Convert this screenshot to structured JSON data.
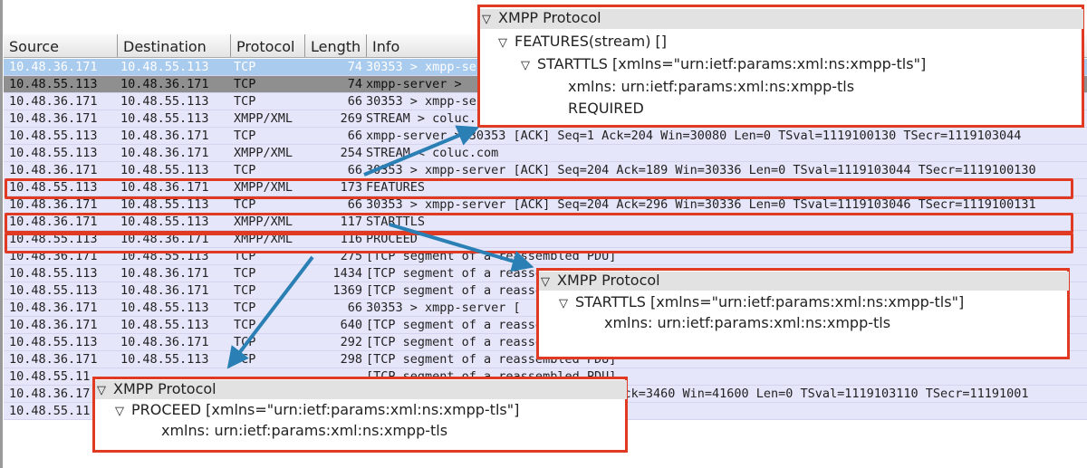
{
  "columns": [
    "Source",
    "Destination",
    "Protocol",
    "Length",
    "Info"
  ],
  "rows": [
    {
      "src": "10.48.36.171",
      "dst": "10.48.55.113",
      "proto": "TCP",
      "len": "74",
      "info": "30353 > xmpp-server",
      "state": "selected"
    },
    {
      "src": "10.48.55.113",
      "dst": "10.48.36.171",
      "proto": "TCP",
      "len": "74",
      "info": "xmpp-server >",
      "state": "marked"
    },
    {
      "src": "10.48.36.171",
      "dst": "10.48.55.113",
      "proto": "TCP",
      "len": "66",
      "info": "30353 > xmpp-server"
    },
    {
      "src": "10.48.36.171",
      "dst": "10.48.55.113",
      "proto": "XMPP/XML",
      "len": "269",
      "info": "STREAM > coluc.com"
    },
    {
      "src": "10.48.55.113",
      "dst": "10.48.36.171",
      "proto": "TCP",
      "len": "66",
      "info": "xmpp-server > 30353 [ACK] Seq=1 Ack=204 Win=30080 Len=0 TSval=1119100130 TSecr=1119103044"
    },
    {
      "src": "10.48.55.113",
      "dst": "10.48.36.171",
      "proto": "XMPP/XML",
      "len": "254",
      "info": "STREAM < coluc.com"
    },
    {
      "src": "10.48.36.171",
      "dst": "10.48.55.113",
      "proto": "TCP",
      "len": "66",
      "info": "30353 > xmpp-server [ACK] Seq=204 Ack=189 Win=30336 Len=0 TSval=1119103044 TSecr=1119100130"
    },
    {
      "src": "10.48.55.113",
      "dst": "10.48.36.171",
      "proto": "XMPP/XML",
      "len": "173",
      "info": "FEATURES"
    },
    {
      "src": "10.48.36.171",
      "dst": "10.48.55.113",
      "proto": "TCP",
      "len": "66",
      "info": "30353 > xmpp-server [ACK] Seq=204 Ack=296 Win=30336 Len=0 TSval=1119103046 TSecr=1119100131"
    },
    {
      "src": "10.48.36.171",
      "dst": "10.48.55.113",
      "proto": "XMPP/XML",
      "len": "117",
      "info": "STARTTLS"
    },
    {
      "src": "10.48.55.113",
      "dst": "10.48.36.171",
      "proto": "XMPP/XML",
      "len": "116",
      "info": "PROCEED"
    },
    {
      "src": "10.48.36.171",
      "dst": "10.48.55.113",
      "proto": "TCP",
      "len": "275",
      "info": "[TCP segment of a reassembled PDU]"
    },
    {
      "src": "10.48.55.113",
      "dst": "10.48.36.171",
      "proto": "TCP",
      "len": "1434",
      "info": "[TCP segment of a reassembled PDU]"
    },
    {
      "src": "10.48.55.113",
      "dst": "10.48.36.171",
      "proto": "TCP",
      "len": "1369",
      "info": "[TCP segment of a reassembled PDU]"
    },
    {
      "src": "10.48.36.171",
      "dst": "10.48.55.113",
      "proto": "TCP",
      "len": "66",
      "info": "30353 > xmpp-server [                                                                  84"
    },
    {
      "src": "10.48.36.171",
      "dst": "10.48.55.113",
      "proto": "TCP",
      "len": "640",
      "info": "[TCP segment of a reassembled PDU]"
    },
    {
      "src": "10.48.55.113",
      "dst": "10.48.36.171",
      "proto": "TCP",
      "len": "292",
      "info": "[TCP segment of a reassembled PDU]"
    },
    {
      "src": "10.48.36.171",
      "dst": "10.48.55.113",
      "proto": "TCP",
      "len": "298",
      "info": "[TCP segment of a reassembled PDU]"
    },
    {
      "src": "10.48.55.11",
      "dst": "",
      "proto": "",
      "len": "",
      "info": "[TCP segment of a reassembled PDU]"
    },
    {
      "src": "10.48.36.17",
      "dst": "",
      "proto": "",
      "len": "",
      "info": "                                0 Ack=3460 Win=41600 Len=0 TSval=1119103110 TSecr=11191001"
    },
    {
      "src": "10.48.55.11",
      "dst": "",
      "proto": "",
      "len": "",
      "info": ""
    }
  ],
  "popups": {
    "features": {
      "title": "XMPP Protocol",
      "l1": "FEATURES(stream) []",
      "l2": "STARTTLS [xmlns=\"urn:ietf:params:xml:ns:xmpp-tls\"]",
      "l3": "xmlns: urn:ietf:params:xml:ns:xmpp-tls",
      "l4": "REQUIRED"
    },
    "starttls": {
      "title": "XMPP Protocol",
      "l1": "STARTTLS [xmlns=\"urn:ietf:params:xml:ns:xmpp-tls\"]",
      "l2": "xmlns: urn:ietf:params:xml:ns:xmpp-tls"
    },
    "proceed": {
      "title": "XMPP Protocol",
      "l1": "PROCEED [xmlns=\"urn:ietf:params:xml:ns:xmpp-tls\"]",
      "l2": "xmlns: urn:ietf:params:xml:ns:xmpp-tls"
    }
  },
  "colors": {
    "highlight": "#e03a22",
    "arrow": "#2a80b4",
    "selected_row": "#a9cbee",
    "row": "#e6e6fb"
  },
  "icons": {
    "expand": "triangle-down-icon"
  }
}
